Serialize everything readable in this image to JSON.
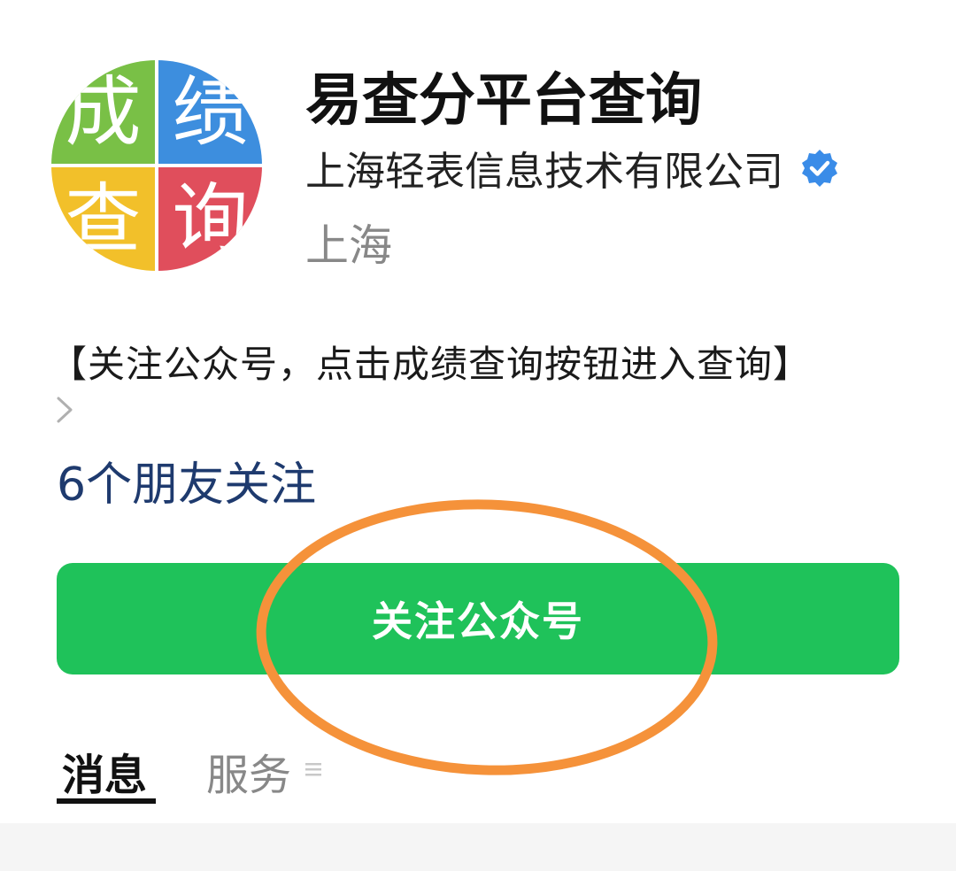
{
  "logo": {
    "chars": [
      "成",
      "绩",
      "查",
      "询"
    ],
    "colors": [
      "#79c046",
      "#3d8ede",
      "#f2c02a",
      "#e04e5c"
    ],
    "icon": "app-logo"
  },
  "account": {
    "name": "易查分平台查询",
    "company": "上海轻表信息技术有限公司",
    "verified_icon": "verified-badge-icon",
    "region": "上海"
  },
  "description": "【关注公众号，点击成绩查询按钮进入查询】",
  "friends_following": "6个朋友关注",
  "follow_button": {
    "label": "关注公众号",
    "color": "#1fc25a"
  },
  "highlight_color": "#f5923a",
  "tabs": [
    {
      "label": "消息",
      "active": true
    },
    {
      "label": "服务",
      "active": false
    }
  ]
}
